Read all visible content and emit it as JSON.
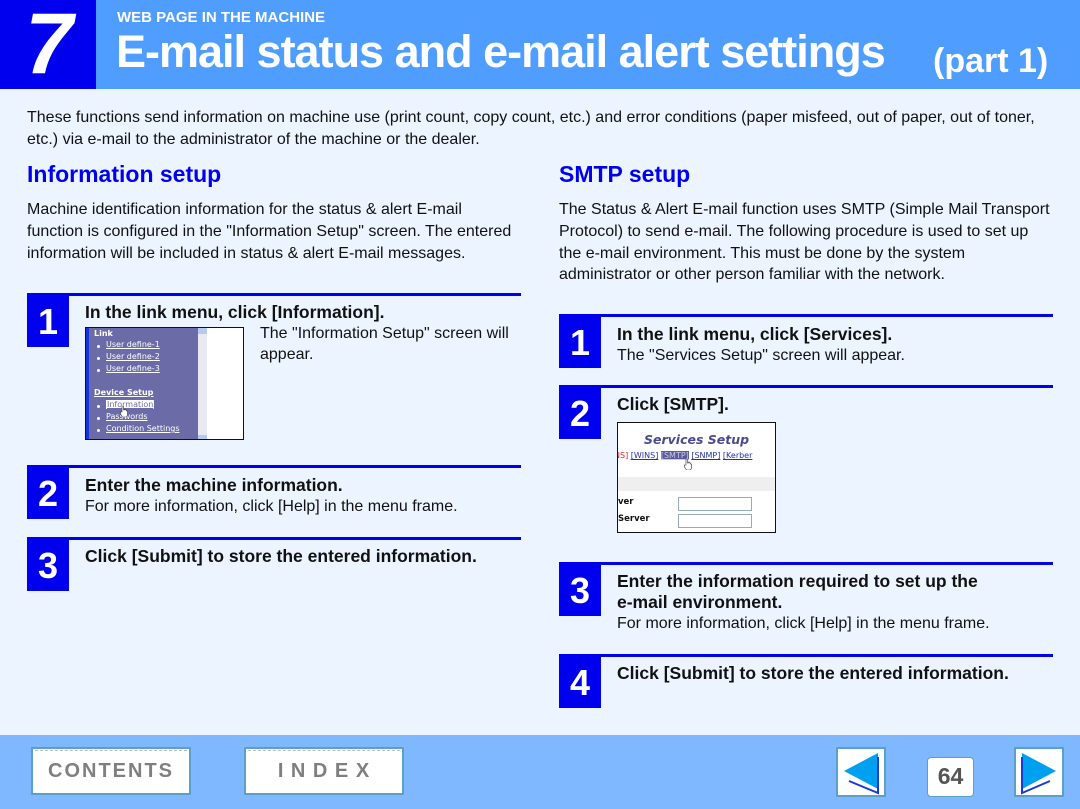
{
  "header": {
    "chapter_number": "7",
    "kicker": "WEB PAGE IN THE MACHINE",
    "title": "E-mail status and e-mail alert settings",
    "title_part": "(part 1)"
  },
  "intro": "These functions send information on machine use (print count, copy count, etc.) and error conditions (paper misfeed, out of paper, out of toner, etc.) via e-mail to the administrator of the machine or the dealer.",
  "information_setup": {
    "heading": "Information setup",
    "description": "Machine identification information for the status & alert E-mail function is configured in the \"Information Setup\" screen. The entered information will be included in status & alert E-mail messages.",
    "steps": [
      {
        "number": "1",
        "title": "In the link menu, click [Information].",
        "text": "The \"Information Setup\" screen will appear."
      },
      {
        "number": "2",
        "title": "Enter the machine information.",
        "text": "For more information, click [Help] in the menu frame."
      },
      {
        "number": "3",
        "title": "Click [Submit] to store the entered information.",
        "text": ""
      }
    ],
    "screenshot": {
      "section1_title": "Link",
      "section1_items": [
        "User define-1",
        "User define-2",
        "User define-3"
      ],
      "section2_title": "Device Setup",
      "section2_items": [
        "Information",
        "Passwords",
        "Condition Settings"
      ],
      "selected_item": "Information"
    }
  },
  "smtp_setup": {
    "heading": "SMTP setup",
    "description": "The Status & Alert E-mail function uses SMTP (Simple Mail Transport Protocol) to send e-mail. The following procedure is used to set up the e-mail environment. This must be done by the system administrator or other person familiar with the network.",
    "steps": [
      {
        "number": "1",
        "title": "In the link menu, click [Services].",
        "text": "The \"Services Setup\" screen will appear."
      },
      {
        "number": "2",
        "title": "Click [SMTP].",
        "text": ""
      },
      {
        "number": "3",
        "title": "Enter the information required to set up the",
        "title_line2": "e-mail environment.",
        "text": "For more information, click [Help] in the menu frame."
      },
      {
        "number": "4",
        "title": "Click [Submit] to store the entered information.",
        "text": ""
      }
    ],
    "screenshot": {
      "title": "Services Setup",
      "tab_partial_left": "NS]",
      "tabs": [
        "[WINS]",
        "[SMTP]",
        "[SNMP]",
        "[Kerber"
      ],
      "selected_tab": "[SMTP]",
      "field_labels": [
        "ver",
        "Server"
      ],
      "field_values": [
        "",
        ""
      ]
    }
  },
  "footer": {
    "contents_label": "CONTENTS",
    "index_label": "I N D E X",
    "page_number": "64",
    "prev_icon": "left-arrow",
    "next_icon": "right-arrow"
  },
  "colors": {
    "header_bg": "#4f9dff",
    "chapter_bg": "#0000ee",
    "accent": "#0000ee",
    "page_bg": "#ebf4ff",
    "footer_bg": "#80b8ff",
    "arrow": "#00a0f0"
  }
}
